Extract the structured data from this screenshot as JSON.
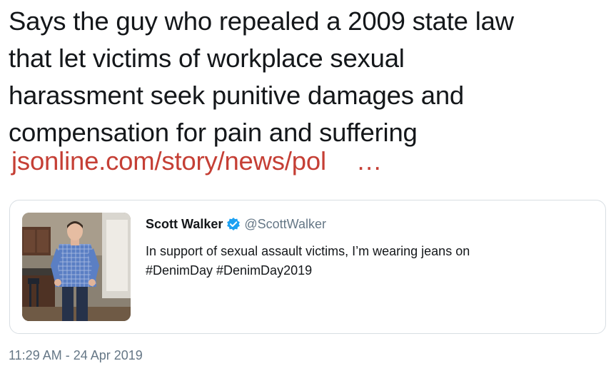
{
  "tweet": {
    "text_lines": [
      "Says the guy who repealed a 2009 state law",
      "that let victims of workplace sexual",
      "harassment seek punitive damages and",
      "compensation for pain and suffering"
    ],
    "link_text": "jsonline.com/story/news/pol",
    "link_ellipsis": "…",
    "link_color": "#c53f35"
  },
  "quoted_tweet": {
    "author_name": "Scott Walker",
    "author_handle": "@ScottWalker",
    "verified_icon": "verified-badge-icon",
    "verified_color": "#1da1f2",
    "text_lines": [
      "In support of sexual assault victims, I’m wearing jeans on",
      "#DenimDay #DenimDay2019"
    ]
  },
  "timestamp": "11:29 AM - 24 Apr 2019"
}
